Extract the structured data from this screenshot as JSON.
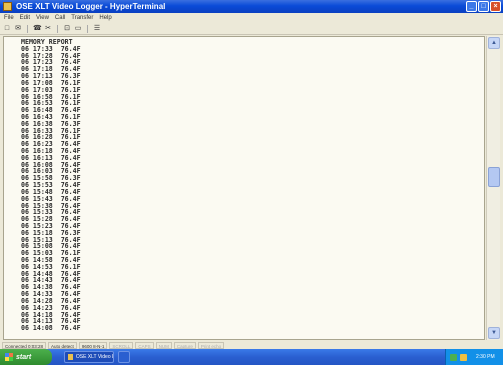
{
  "window": {
    "title": "OSE XLT Video Logger - HyperTerminal",
    "buttons": {
      "minimize": "_",
      "maximize": "□",
      "close": "×"
    }
  },
  "menu": [
    "File",
    "Edit",
    "View",
    "Call",
    "Transfer",
    "Help"
  ],
  "toolbar": [
    "□",
    "✉",
    "☎",
    "✂",
    "⊡",
    "▭",
    "☰"
  ],
  "terminal": {
    "heading": "MEMORY REPORT",
    "lines": [
      "06 17:33  76.4F",
      "06 17:28  76.4F",
      "06 17:23  76.4F",
      "06 17:18  76.4F",
      "06 17:13  76.3F",
      "06 17:08  76.1F",
      "06 17:03  76.1F",
      "06 16:58  76.1F",
      "06 16:53  76.1F",
      "06 16:48  76.4F",
      "06 16:43  76.1F",
      "06 16:38  76.3F",
      "06 16:33  76.1F",
      "06 16:28  76.1F",
      "06 16:23  76.4F",
      "06 16:18  76.4F",
      "06 16:13  76.4F",
      "06 16:08  76.4F",
      "06 16:03  76.4F",
      "06 15:58  76.3F",
      "06 15:53  76.4F",
      "06 15:48  76.4F",
      "06 15:43  76.4F",
      "06 15:38  76.4F",
      "06 15:33  76.4F",
      "06 15:28  76.4F",
      "06 15:23  76.4F",
      "06 15:18  76.3F",
      "06 15:13  76.4F",
      "06 15:08  76.4F",
      "06 15:03  76.1F",
      "06 14:58  76.4F",
      "06 14:53  76.1F",
      "06 14:48  76.4F",
      "06 14:43  76.4F",
      "06 14:38  76.4F",
      "06 14:33  76.4F",
      "06 14:28  76.4F",
      "06 14:23  76.4F",
      "06 14:18  76.4F",
      "06 14:13  76.4F",
      "06 14:08  76.4F"
    ]
  },
  "statusbar": [
    "Connected 0:03:28",
    "Auto detect",
    "9600 8-N-1",
    "SCROLL",
    "CAPS",
    "NUM",
    "Capture",
    "Print echo"
  ],
  "taskbar": {
    "start_label": "start",
    "task_label": "OSE XLT Video Lo...",
    "clock": "2:30 PM"
  }
}
